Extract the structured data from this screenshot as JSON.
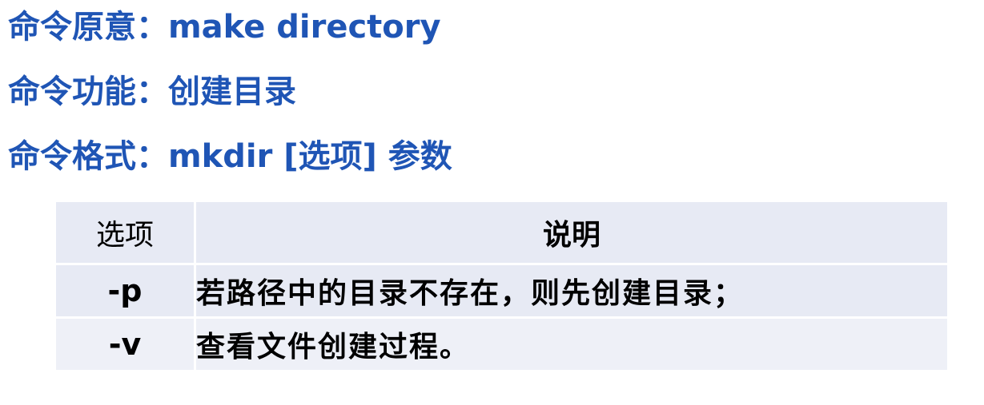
{
  "headings": {
    "origin": "命令原意：make directory",
    "function": "命令功能：创建目录",
    "format": "命令格式：mkdir [选项] 参数"
  },
  "table": {
    "headers": {
      "option": "选项",
      "description": "说明"
    },
    "rows": [
      {
        "option": "-p",
        "description": "若路径中的目录不存在，则先创建目录；"
      },
      {
        "option": "-v",
        "description": "查看文件创建过程。"
      }
    ]
  },
  "colors": {
    "heading_text": "#1f55b5",
    "table_fill": "#e7eaf4",
    "table_fill_alt": "#eef0f7"
  }
}
